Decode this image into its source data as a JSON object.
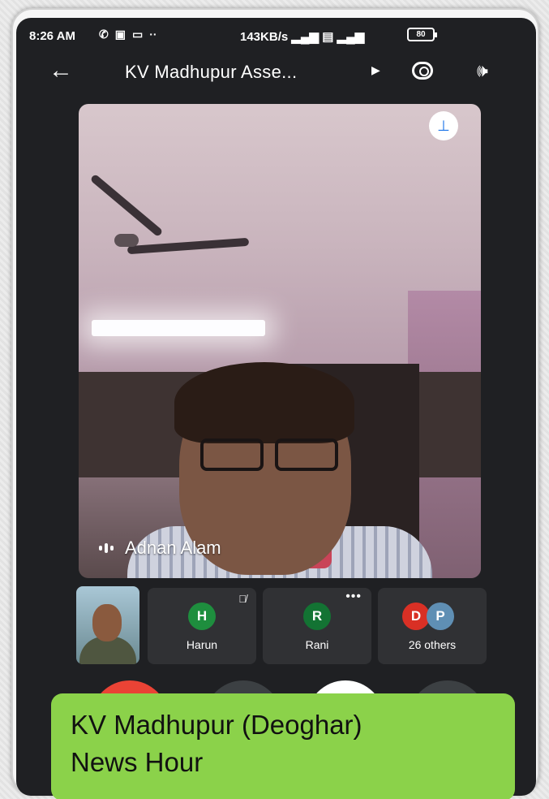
{
  "status_bar": {
    "time": "8:26 AM",
    "notif_icons": [
      "whatsapp-icon",
      "gallery-icon",
      "video-icon",
      "more-dots-icon"
    ],
    "network_speed": "143KB/s",
    "battery": "80"
  },
  "app_bar": {
    "title": "KV Madhupur Asse..."
  },
  "main_video": {
    "speaker_name": "Adnan Alam"
  },
  "participants": [
    {
      "initial": "H",
      "name": "Harun",
      "color": "#1e8e3e",
      "muted": true
    },
    {
      "initial": "R",
      "name": "Rani",
      "color": "#137333",
      "muted": false
    },
    {
      "initials": [
        "D",
        "P"
      ],
      "name": "26 others",
      "colors": [
        "#d93025",
        "#5f8fb4"
      ]
    }
  ],
  "caption": {
    "line1": "KV Madhupur (Deoghar)",
    "line2": "News Hour"
  },
  "colors": {
    "caption_bg": "#8bd24a",
    "end_call": "#ea4335",
    "screen_bg": "#1f2023"
  }
}
